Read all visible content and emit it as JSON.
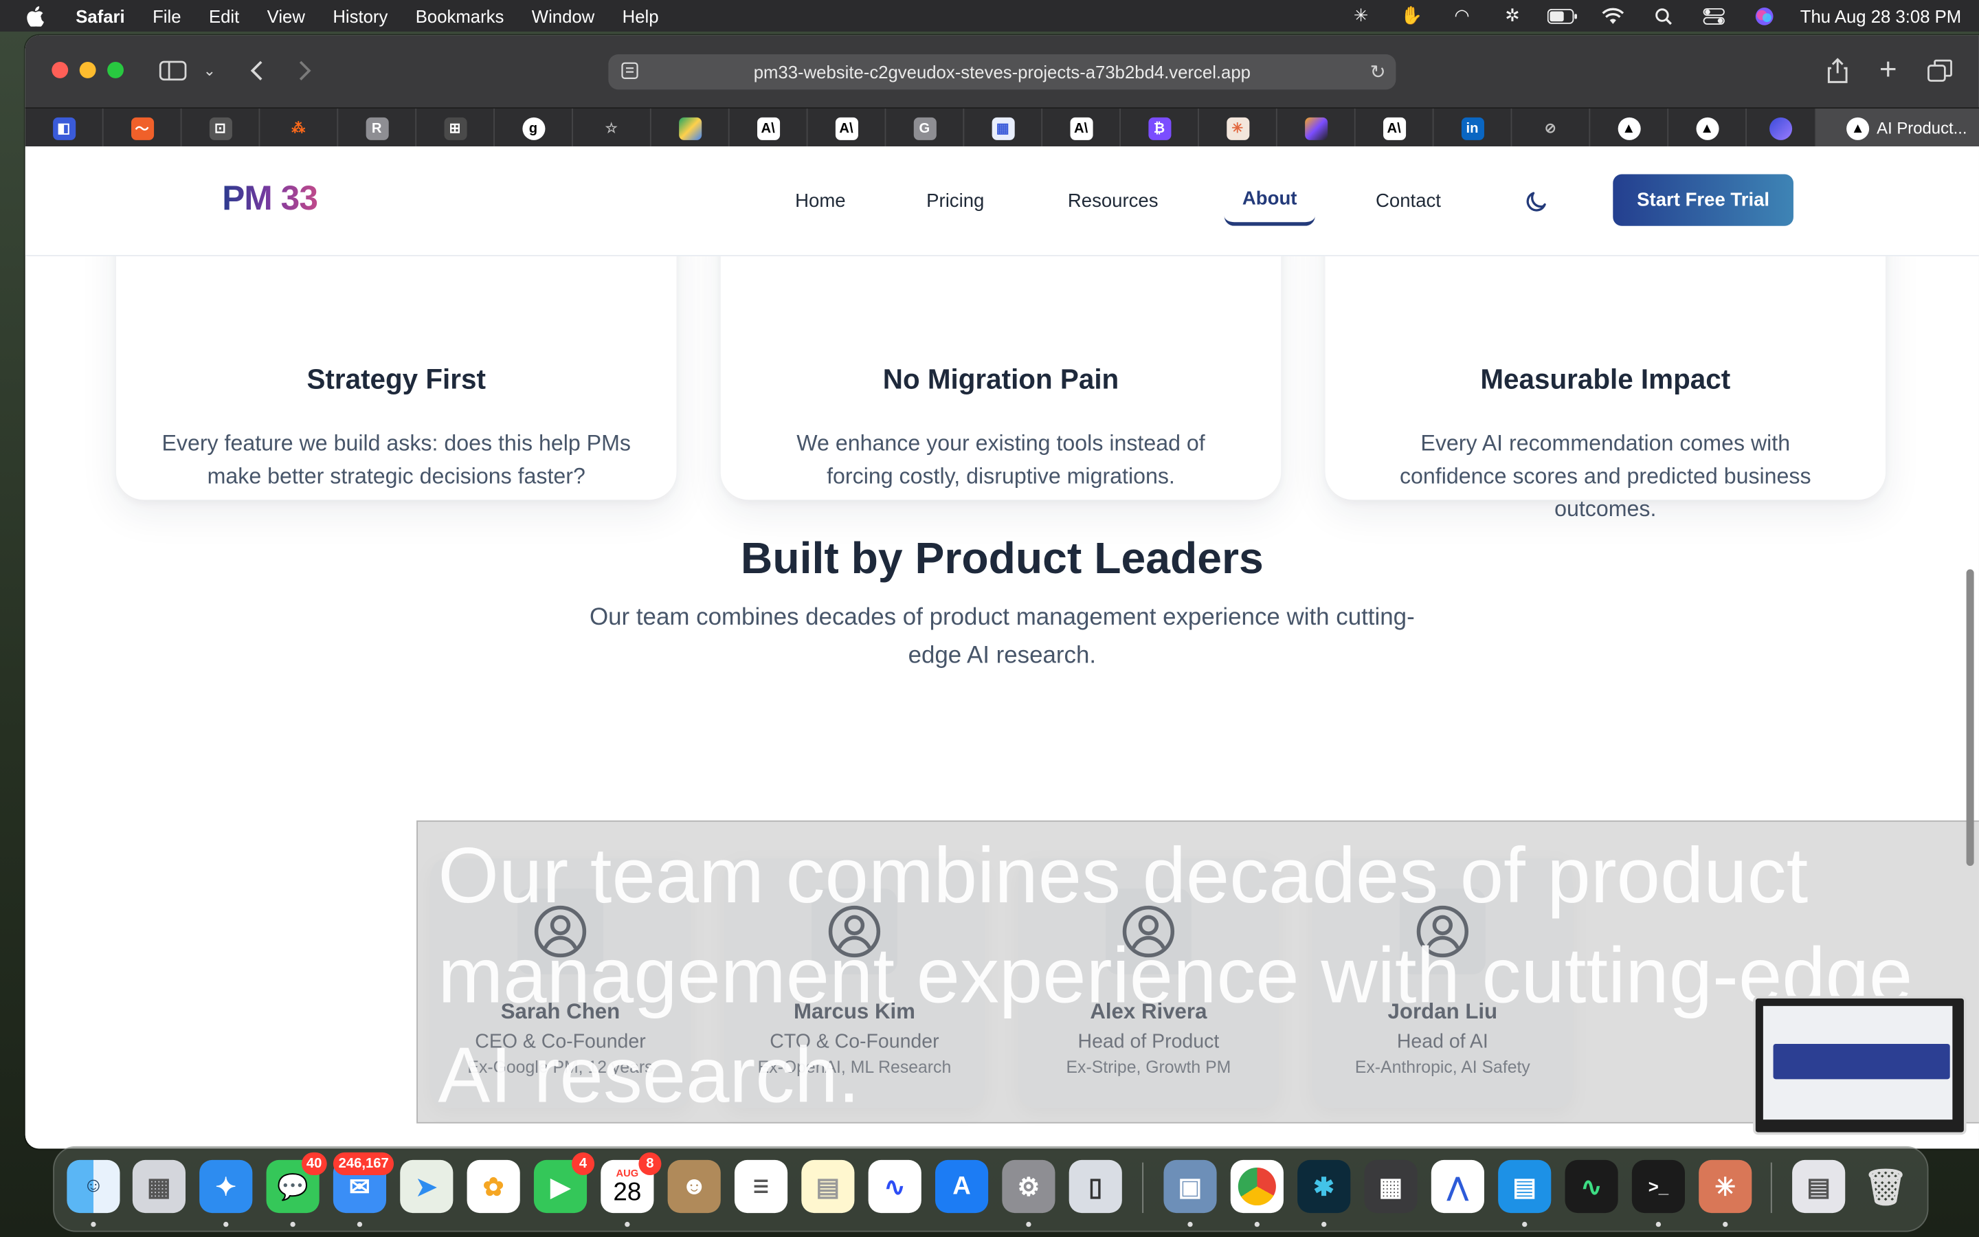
{
  "menubar": {
    "app": "Safari",
    "items": [
      "File",
      "Edit",
      "View",
      "History",
      "Bookmarks",
      "Window",
      "Help"
    ],
    "clock": "Thu Aug 28  3:08 PM"
  },
  "browser": {
    "url": "pm33-website-c2gveudox-steves-projects-a73b2bd4.vercel.app",
    "active_tab_title": "AI Product..."
  },
  "site": {
    "logo": "PM 33",
    "nav": {
      "home": "Home",
      "pricing": "Pricing",
      "resources": "Resources",
      "about": "About",
      "contact": "Contact"
    },
    "cta": "Start Free Trial"
  },
  "values": [
    {
      "title": "Strategy First",
      "text": "Every feature we build asks: does this help PMs make better strategic decisions faster?"
    },
    {
      "title": "No Migration Pain",
      "text": "We enhance your existing tools instead of forcing costly, disruptive migrations."
    },
    {
      "title": "Measurable Impact",
      "text": "Every AI recommendation comes with confidence scores and predicted business outcomes."
    }
  ],
  "team_section": {
    "title": "Built by Product Leaders",
    "subtitle": "Our team combines decades of product management experience with cutting-edge AI research."
  },
  "team": [
    {
      "name": "Sarah Chen",
      "role": "CEO & Co-Founder",
      "background": "Ex-Google PM, 12 years"
    },
    {
      "name": "Marcus Kim",
      "role": "CTO & Co-Founder",
      "background": "Ex-OpenAI, ML Research"
    },
    {
      "name": "Alex Rivera",
      "role": "Head of Product",
      "background": "Ex-Stripe, Growth PM"
    },
    {
      "name": "Jordan Liu",
      "role": "Head of AI",
      "background": "Ex-Anthropic, AI Safety"
    }
  ],
  "caption_overlay": "Our team combines decades of product management experience with cutting-edge AI research.",
  "dock": {
    "badges": {
      "messages": "40",
      "mail": "246,167",
      "facetime": "4",
      "calendar": "8"
    },
    "calendar_month": "AUG",
    "calendar_day": "28"
  },
  "colors": {
    "brand": "#233a7a",
    "cta_start": "#243f8f",
    "cta_end": "#3e84b5",
    "heading": "#1e293b",
    "body": "#475569"
  }
}
